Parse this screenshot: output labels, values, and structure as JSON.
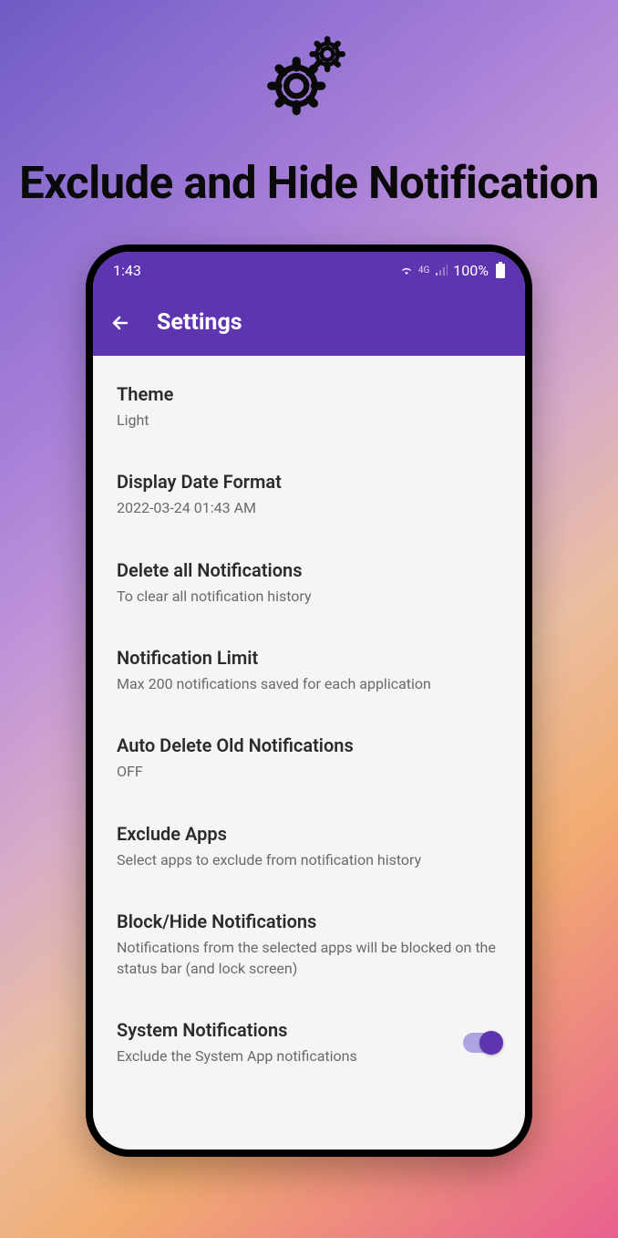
{
  "promo": {
    "title": "Exclude and Hide Notification"
  },
  "status": {
    "time": "1:43",
    "network": "4G",
    "battery": "100%"
  },
  "appbar": {
    "title": "Settings"
  },
  "settings": [
    {
      "title": "Theme",
      "subtitle": "Light"
    },
    {
      "title": "Display Date Format",
      "subtitle": "2022-03-24 01:43 AM"
    },
    {
      "title": "Delete all Notifications",
      "subtitle": "To clear all notification history"
    },
    {
      "title": "Notification Limit",
      "subtitle": "Max 200 notifications saved for each application"
    },
    {
      "title": "Auto Delete Old Notifications",
      "subtitle": "OFF"
    },
    {
      "title": "Exclude Apps",
      "subtitle": "Select apps to exclude from notification history"
    },
    {
      "title": "Block/Hide Notifications",
      "subtitle": "Notifications from the selected apps will be blocked on the status bar (and lock screen)"
    },
    {
      "title": "System Notifications",
      "subtitle": "Exclude the System App notifications"
    }
  ]
}
